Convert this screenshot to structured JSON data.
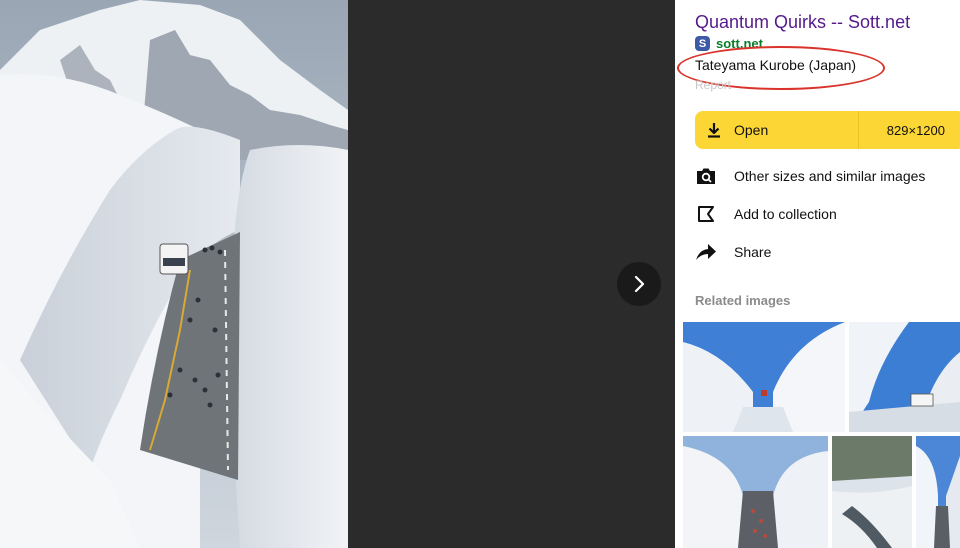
{
  "viewer": {
    "main_image_icon": "snow-corridor-photo",
    "next_icon": "chevron-right-icon"
  },
  "sidebar": {
    "title": "Quantum Quirks -- Sott.net",
    "source_badge": "S",
    "source_domain": "sott.net",
    "caption": "Tateyama Kurobe (Japan)",
    "report_label": "Report",
    "open_button": {
      "label": "Open",
      "size": "829×1200",
      "icon": "download-icon",
      "color": "#fcd635"
    },
    "actions": [
      {
        "label": "Other sizes and similar images",
        "icon": "camera-search-icon"
      },
      {
        "label": "Add to collection",
        "icon": "bookmark-icon"
      },
      {
        "label": "Share",
        "icon": "share-arrow-icon"
      }
    ],
    "related_heading": "Related images"
  },
  "colors": {
    "title_link": "#551a8b",
    "source_green": "#0a7d2c",
    "annotation_red": "#d9332b",
    "viewer_bg": "#2b2b2b"
  }
}
